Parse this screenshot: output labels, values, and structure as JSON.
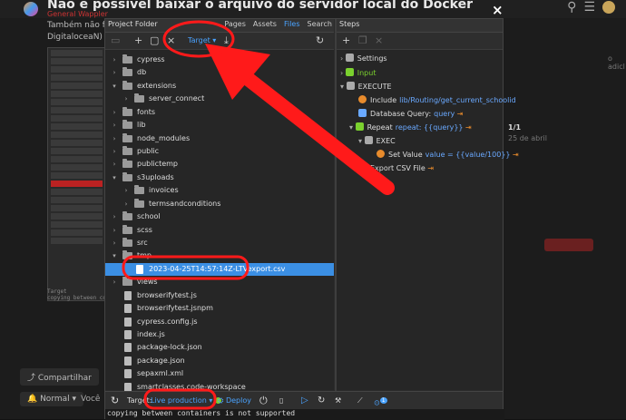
{
  "background": {
    "title": "Não é possível baixar o arquivo do servidor local do Docker",
    "category": "General Wappler",
    "text_line1": "Também não fun",
    "text_line2": "DigitaloceaN)",
    "share_label": "Compartilhar",
    "notify_label": "Normal",
    "you_label": "Você",
    "right_page": "1/1",
    "right_date": "25 de abril",
    "right_side1": "o adicl",
    "console_snip1": "Target",
    "console_snip2": "copying between conta"
  },
  "window": {
    "close_symbol": "×"
  },
  "project_folder": {
    "title": "Project Folder",
    "tabs": [
      {
        "label": "Pages",
        "active": false
      },
      {
        "label": "Assets",
        "active": false
      },
      {
        "label": "Files",
        "active": true
      },
      {
        "label": "Search",
        "active": false
      }
    ],
    "toolbar": {
      "target_label": "Target"
    },
    "tree": [
      {
        "name": "cypress",
        "type": "folder",
        "depth": 0,
        "expanded": false
      },
      {
        "name": "db",
        "type": "folder",
        "depth": 0,
        "expanded": false
      },
      {
        "name": "extensions",
        "type": "folder",
        "depth": 0,
        "expanded": true
      },
      {
        "name": "server_connect",
        "type": "folder",
        "depth": 1,
        "expanded": false
      },
      {
        "name": "fonts",
        "type": "folder",
        "depth": 0,
        "expanded": false
      },
      {
        "name": "lib",
        "type": "folder",
        "depth": 0,
        "expanded": false
      },
      {
        "name": "node_modules",
        "type": "folder",
        "depth": 0,
        "expanded": false
      },
      {
        "name": "public",
        "type": "folder",
        "depth": 0,
        "expanded": false
      },
      {
        "name": "publictemp",
        "type": "folder",
        "depth": 0,
        "expanded": false
      },
      {
        "name": "s3uploads",
        "type": "folder",
        "depth": 0,
        "expanded": true
      },
      {
        "name": "invoices",
        "type": "folder",
        "depth": 1,
        "expanded": false
      },
      {
        "name": "termsandconditions",
        "type": "folder",
        "depth": 1,
        "expanded": false
      },
      {
        "name": "school",
        "type": "folder",
        "depth": 0,
        "expanded": false
      },
      {
        "name": "scss",
        "type": "folder",
        "depth": 0,
        "expanded": false
      },
      {
        "name": "src",
        "type": "folder",
        "depth": 0,
        "expanded": false
      },
      {
        "name": "tmp",
        "type": "folder",
        "depth": 0,
        "expanded": true
      },
      {
        "name": "2023-04-25T14:57:14Z-LTVexport.csv",
        "type": "file",
        "depth": 1,
        "selected": true
      },
      {
        "name": "views",
        "type": "folder",
        "depth": 0,
        "expanded": false
      },
      {
        "name": "browserifytest.js",
        "type": "file",
        "depth": 0
      },
      {
        "name": "browserifytest.jsnpm",
        "type": "file",
        "depth": 0
      },
      {
        "name": "cypress.config.js",
        "type": "file",
        "depth": 0
      },
      {
        "name": "index.js",
        "type": "file",
        "depth": 0
      },
      {
        "name": "package-lock.json",
        "type": "file",
        "depth": 0
      },
      {
        "name": "package.json",
        "type": "file",
        "depth": 0
      },
      {
        "name": "sepaxml.xml",
        "type": "file",
        "depth": 0
      },
      {
        "name": "smartclasses.code-workspace",
        "type": "file",
        "depth": 0
      }
    ]
  },
  "steps_panel": {
    "title": "Steps",
    "items": [
      {
        "label": "Settings",
        "icon": "gear-icon",
        "depth": 0
      },
      {
        "label": "Input",
        "icon": "input-icon",
        "depth": 0,
        "color": "#7bd12e"
      },
      {
        "label": "EXECUTE",
        "icon": "execute-icon",
        "depth": 0
      },
      {
        "label": "Include",
        "value": "lib/Routing/get_current_schoolid",
        "icon": "include-icon",
        "depth": 1
      },
      {
        "label": "Database Query:",
        "value": "query",
        "icon": "database-icon",
        "depth": 1
      },
      {
        "label": "Repeat",
        "value": "repeat: {{query}}",
        "icon": "repeat-icon",
        "depth": 1
      },
      {
        "label": "EXEC",
        "icon": "exec-icon",
        "depth": 2
      },
      {
        "label": "Set Value",
        "value": "value = {{value/100}}",
        "icon": "set-value-icon",
        "depth": 3
      },
      {
        "label": "Export CSV File",
        "icon": "export-icon",
        "depth": 1
      }
    ]
  },
  "bottombar": {
    "target_label": "Target:",
    "live_label": "Live production",
    "deploy_label": "Deploy",
    "badge": "1"
  },
  "console": {
    "message": "copying between containers is not supported"
  },
  "colors": {
    "accent": "#4aa3ff",
    "selection": "#3b8fe4",
    "annotation_red": "#ff1a1a",
    "live_green": "#7bd12e"
  }
}
